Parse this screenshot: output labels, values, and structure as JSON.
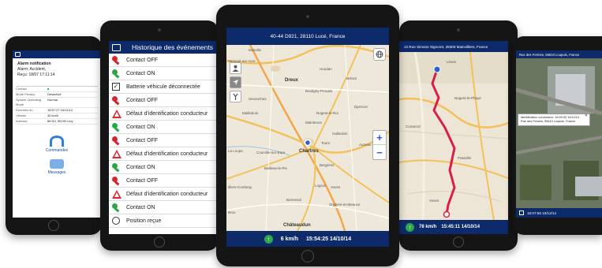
{
  "colors": {
    "header_navy": "#0d2a6b",
    "key_red": "#d9232d",
    "key_green": "#28a845",
    "warning_red": "#e0262e",
    "route_red": "#d61f4a",
    "map_blue": "#2b5ed0"
  },
  "tablet1": {
    "alarm_title": "Alarm notification",
    "alarm_type": "Alarm: Accident,",
    "received": "Reçu: 18/07 17:11:14",
    "rows": [
      {
        "label": "Contact",
        "value": "■"
      },
      {
        "label": "Mode Privacy",
        "value": "Désactivé"
      },
      {
        "label": "System Operating Mode",
        "value": "Normal"
      },
      {
        "label": "Données du",
        "value": "18:57:27 04/11/14"
      },
      {
        "label": "Vitesse",
        "value": "30 km/h"
      },
      {
        "label": "Adresse",
        "value": "86 N3, 55190 Liny"
      }
    ],
    "commands_label": "Commandes",
    "messages_label": "Messages"
  },
  "tablet2": {
    "title": "Historique des événements",
    "events": [
      {
        "icon": "key-red-icon",
        "label": "Contact OFF"
      },
      {
        "icon": "key-green-icon",
        "label": "Contact ON"
      },
      {
        "icon": "checkbox-icon",
        "label": "Batterie véhicule déconnectée"
      },
      {
        "icon": "key-red-icon",
        "label": "Contact OFF"
      },
      {
        "icon": "warning-icon",
        "label": "Défaut d'identification conducteur"
      },
      {
        "icon": "key-green-icon",
        "label": "Contact ON"
      },
      {
        "icon": "key-red-icon",
        "label": "Contact OFF"
      },
      {
        "icon": "warning-icon",
        "label": "Défaut d'identification conducteur"
      },
      {
        "icon": "key-green-icon",
        "label": "Contact ON"
      },
      {
        "icon": "key-red-icon",
        "label": "Contact OFF"
      },
      {
        "icon": "warning-icon",
        "label": "Défaut d'identification conducteur"
      },
      {
        "icon": "key-green-icon",
        "label": "Contact ON"
      },
      {
        "icon": "pin-icon",
        "label": "Position reçue"
      }
    ]
  },
  "tablet3": {
    "address": "40-44 D921, 28110 Lucé, France",
    "speed": "6 km/h",
    "timestamp": "15:54:25 14/10/14",
    "zoom_in": "+",
    "zoom_out": "−",
    "map_labels": [
      "Danville",
      "Verneuil-sur-Avre",
      "Houdan",
      "Dreux",
      "Bréval",
      "Boutigny-Prouais",
      "Senonches",
      "Maillebois",
      "Nogent-le-Roi",
      "Maintenon",
      "Gallardon",
      "Chartres",
      "Courville-sur-Eure",
      "Illiers-Combray",
      "Bailleau-le-Pin",
      "Voves",
      "Bonneval",
      "Auneau",
      "Orgères-en-Beauce",
      "Châteaudun",
      "Brou",
      "Épernon",
      "Tours",
      "La Loupe",
      "Bergères",
      "Logron"
    ]
  },
  "tablet4": {
    "address": "12 Rue Simone Signoret, 28300 Mainvilliers, France",
    "speed": "78 km/h",
    "timestamp": "15:45:11 14/10/14"
  },
  "tablet5": {
    "header": "Rue des Fermes, 55610 Loupuis, France",
    "popup_line1": "Identification conducteur: 15:09:33 10/12/14",
    "popup_line2": "Rue des Fermes, 55610 Loupuis, France",
    "timestamp": "16:07:56 10/12/14"
  }
}
